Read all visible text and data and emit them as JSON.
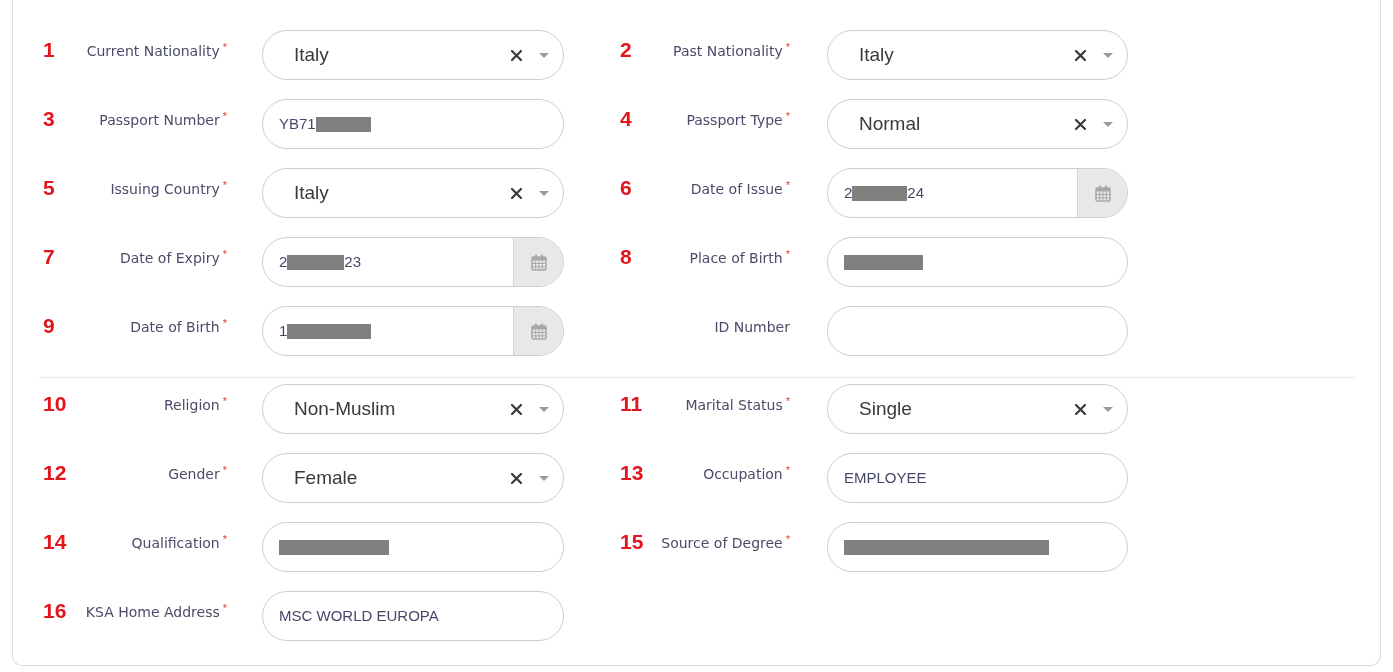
{
  "form": {
    "sections": [
      {
        "fields": [
          {
            "number": "1",
            "label": "Current Nationality",
            "required_mark": "*",
            "kind": "select",
            "value": "Italy"
          },
          {
            "number": "2",
            "label": "Past Nationality",
            "required_mark": "*",
            "kind": "select",
            "value": "Italy"
          },
          {
            "number": "3",
            "label": "Passport Number",
            "required_mark": "*",
            "kind": "text",
            "segments": [
              {
                "kind": "text",
                "text": "YB71"
              },
              {
                "kind": "redacted"
              }
            ]
          },
          {
            "number": "4",
            "label": "Passport Type",
            "required_mark": "*",
            "kind": "select",
            "value": "Normal"
          },
          {
            "number": "5",
            "label": "Issuing Country",
            "required_mark": "*",
            "kind": "select",
            "value": "Italy"
          },
          {
            "number": "6",
            "label": "Date of Issue",
            "required_mark": "*",
            "kind": "date",
            "segments": [
              {
                "kind": "text",
                "text": "2"
              },
              {
                "kind": "redacted"
              },
              {
                "kind": "text",
                "text": "24"
              }
            ]
          },
          {
            "number": "7",
            "label": "Date of Expiry",
            "required_mark": "*",
            "kind": "date",
            "segments": [
              {
                "kind": "text",
                "text": "2"
              },
              {
                "kind": "redacted"
              },
              {
                "kind": "text",
                "text": "23"
              }
            ]
          },
          {
            "number": "8",
            "label": "Place of Birth",
            "required_mark": "*",
            "kind": "text",
            "segments": [
              {
                "kind": "redacted"
              }
            ]
          },
          {
            "number": "9",
            "label": "Date of Birth",
            "required_mark": "*",
            "kind": "date",
            "segments": [
              {
                "kind": "text",
                "text": "1"
              },
              {
                "kind": "redacted"
              }
            ]
          },
          {
            "label": "ID Number",
            "kind": "text"
          }
        ]
      },
      {
        "fields": [
          {
            "number": "10",
            "label": "Religion",
            "required_mark": "*",
            "kind": "select",
            "value": "Non-Muslim"
          },
          {
            "number": "11",
            "label": "Marital Status",
            "required_mark": "*",
            "kind": "select",
            "value": "Single"
          },
          {
            "number": "12",
            "label": "Gender",
            "required_mark": "*",
            "kind": "select",
            "value": "Female"
          },
          {
            "number": "13",
            "label": "Occupation",
            "required_mark": "*",
            "kind": "text",
            "value": "EMPLOYEE"
          },
          {
            "number": "14",
            "label": "Qualification",
            "required_mark": "*",
            "kind": "text",
            "segments": [
              {
                "kind": "redacted"
              }
            ]
          },
          {
            "number": "15",
            "label": "Source of Degree",
            "required_mark": "*",
            "kind": "text",
            "segments": [
              {
                "kind": "redacted"
              }
            ]
          },
          {
            "number": "16",
            "label": "KSA Home Address",
            "required_mark": "*",
            "kind": "text",
            "value": "MSC WORLD EUROPA"
          }
        ]
      }
    ]
  }
}
